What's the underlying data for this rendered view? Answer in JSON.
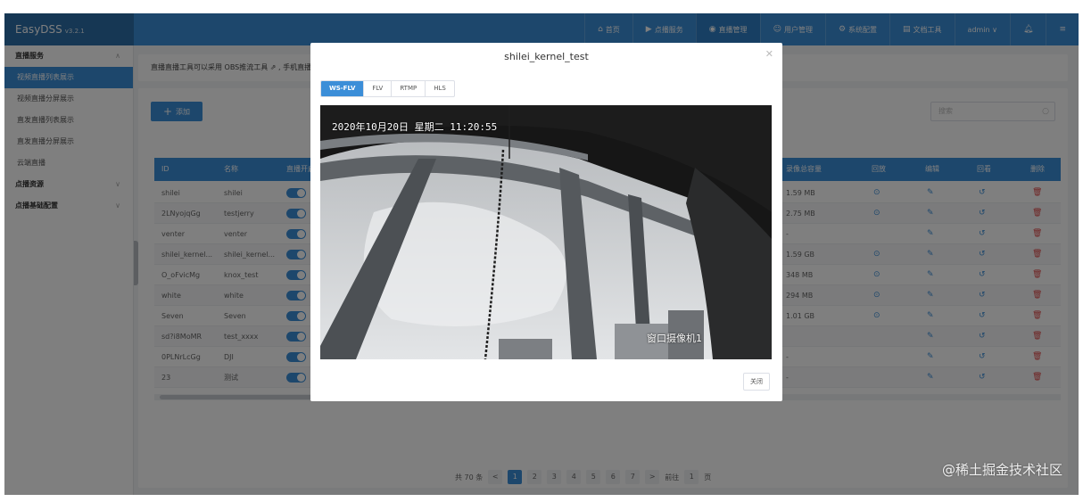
{
  "app": {
    "name": "EasyDSS",
    "version": "v3.2.1"
  },
  "nav": [
    {
      "label": "首页",
      "icon": "home-icon"
    },
    {
      "label": "点播服务",
      "icon": "video-icon"
    },
    {
      "label": "直播管理",
      "icon": "live-icon",
      "active": true
    },
    {
      "label": "用户管理",
      "icon": "user-icon"
    },
    {
      "label": "系统配置",
      "icon": "gear-icon"
    },
    {
      "label": "文档工具",
      "icon": "doc-icon"
    },
    {
      "label": "admin ∨",
      "icon": ""
    }
  ],
  "sidebar": {
    "groups": [
      {
        "label": "直播服务",
        "items": [
          "视频直播列表展示",
          "视频直播分屏展示",
          "直发直播列表展示",
          "直发直播分屏展示",
          "云端直播"
        ]
      },
      {
        "label": "点播资源",
        "items": []
      },
      {
        "label": "点播基础配置",
        "items": []
      }
    ]
  },
  "notice": "直播直播工具可以采用 OBS推流工具 ⇗ , 手机直播 ...",
  "toolbar": {
    "add_label": "添加",
    "search_placeholder": "搜索"
  },
  "table": {
    "headers": [
      "ID",
      "名称",
      "直播开启",
      "录像总容量",
      "回放",
      "编辑",
      "回看",
      "删除"
    ],
    "rows": [
      {
        "id": "shilei",
        "name": "shilei",
        "size": "1.59 MB",
        "replay": true
      },
      {
        "id": "2LNyojqGg",
        "name": "testjerry",
        "size": "2.75 MB",
        "replay": true
      },
      {
        "id": "venter",
        "name": "venter",
        "size": "-",
        "replay": false
      },
      {
        "id": "shilei_kernel...",
        "name": "shilei_kernel...",
        "size": "1.59 GB",
        "replay": true
      },
      {
        "id": "O_oFvicMg",
        "name": "knox_test",
        "size": "348 MB",
        "replay": true
      },
      {
        "id": "white",
        "name": "white",
        "size": "294 MB",
        "replay": true
      },
      {
        "id": "Seven",
        "name": "Seven",
        "size": "1.01 GB",
        "replay": true
      },
      {
        "id": "sd?i8MoMR",
        "name": "test_xxxx",
        "size": "",
        "replay": false
      },
      {
        "id": "0PLNrLcGg",
        "name": "DJI",
        "size": "-",
        "replay": false
      },
      {
        "id": "23",
        "name": "测试",
        "size": "-",
        "replay": false
      }
    ]
  },
  "pagination": {
    "total": "共 70 条",
    "pages": [
      "1",
      "2",
      "3",
      "4",
      "5",
      "6",
      "7"
    ],
    "prev": "<",
    "next": ">",
    "goto": "前往",
    "goto_value": "1",
    "unit": "页"
  },
  "modal": {
    "title": "shilei_kernel_test",
    "tabs": [
      "WS-FLV",
      "FLV",
      "RTMP",
      "HLS"
    ],
    "active_tab": "WS-FLV",
    "osd_time": "2020年10月20日  星期二  11:20:55",
    "osd_camera": "窗口摄像机1",
    "close_label": "关闭"
  },
  "watermark": "@稀土掘金技术社区",
  "colors": {
    "primary": "#3b8ed8",
    "header": "#3b8ed8",
    "danger": "#e04646"
  }
}
